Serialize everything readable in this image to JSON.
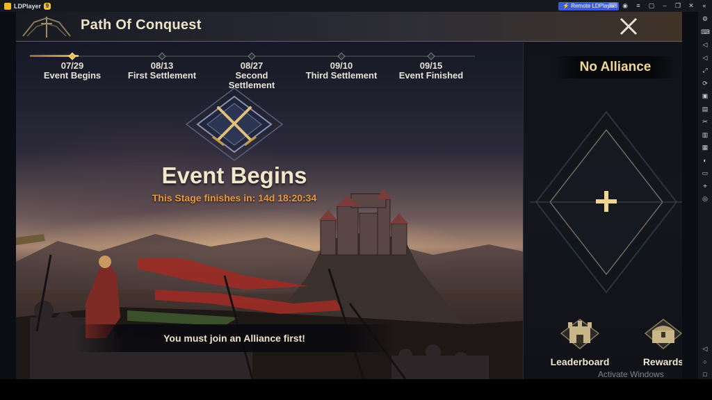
{
  "emulator": {
    "app_name": "LDPlayer",
    "version_badge": "9",
    "remote_label": "Remote LDPlayer",
    "top_icons": [
      "gamepad-icon",
      "account-icon",
      "menu-icon",
      "minimize-window-icon",
      "minimize-icon",
      "restore-icon",
      "close-icon",
      "collapse-sidebar-icon"
    ],
    "side_icons": [
      "settings-icon",
      "keyboard-icon",
      "volume-up-icon",
      "volume-down-icon",
      "resize-icon",
      "sync-icon",
      "install-apk-icon",
      "operations-icon",
      "cut-icon",
      "record-icon",
      "screenshot-icon",
      "rotate-icon",
      "folder-icon",
      "location-icon",
      "shake-icon"
    ],
    "side_bottom_icons": [
      "back-icon",
      "home-icon",
      "recents-icon"
    ]
  },
  "header": {
    "title": "Path Of Conquest",
    "close_icon": "close-x-icon"
  },
  "timeline": {
    "progress_fraction": 0.11,
    "stages": [
      {
        "date": "07/29",
        "label": "Event Begins",
        "active": true
      },
      {
        "date": "08/13",
        "label": "First Settlement",
        "active": false
      },
      {
        "date": "08/27",
        "label": "Second Settlement",
        "active": false
      },
      {
        "date": "09/10",
        "label": "Third Settlement",
        "active": false
      },
      {
        "date": "09/15",
        "label": "Event Finished",
        "active": false
      }
    ]
  },
  "event": {
    "emblem_icon": "crossed-swords-icon",
    "title": "Event Begins",
    "stage_text": "This Stage finishes in: 14d 18:20:34"
  },
  "join_message": "You must join an Alliance first!",
  "alliance": {
    "status": "No Alliance",
    "join_icon": "plus-icon"
  },
  "actions": {
    "leaderboard_label": "Leaderboard",
    "leaderboard_icon": "trophy-castle-icon",
    "rewards_label": "Rewards",
    "rewards_icon": "treasure-chest-icon"
  },
  "watermark": "Activate Windows",
  "colors": {
    "accent_gold": "#e9c06a",
    "orange_text": "#e89a3c",
    "cream_text": "#f2e7cb",
    "remote_blue": "#3b5bdb"
  }
}
